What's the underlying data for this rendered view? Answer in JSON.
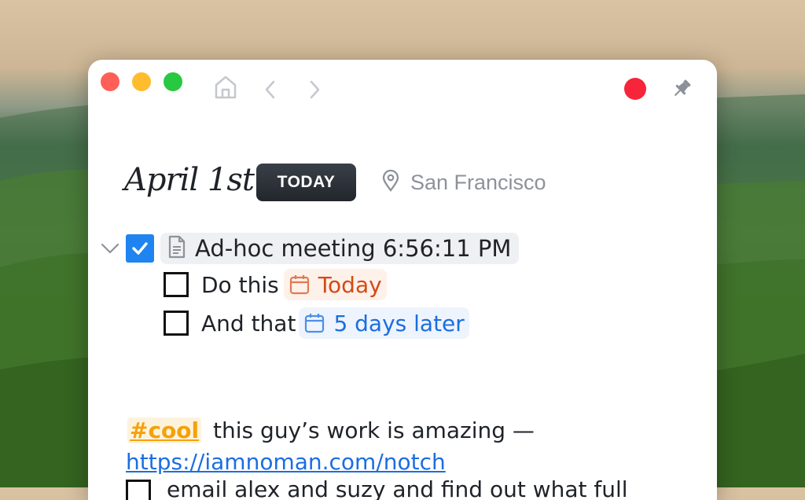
{
  "toolbar": {
    "home_icon": "home-icon",
    "back_icon": "chevron-left-icon",
    "forward_icon": "chevron-right-icon",
    "pin_icon": "pin-icon"
  },
  "header": {
    "title": "April 1st",
    "today_badge": "TODAY",
    "location": "San Francisco"
  },
  "tasks": {
    "parent": {
      "label": "Ad-hoc meeting 6:56:11 PM",
      "checked": true
    },
    "children": [
      {
        "label": "Do this",
        "date": "Today",
        "checked": false
      },
      {
        "label": "And that",
        "date": "5 days later",
        "checked": false
      }
    ]
  },
  "note": {
    "tag": "#cool",
    "text": "this guy’s work is amazing —",
    "link": "https://iamnoman.com/notch",
    "next_line": "email alex and suzy and find out what full"
  },
  "colors": {
    "accent_blue": "#1f84ef",
    "date_orange": "#d34b15",
    "date_blue": "#1b6ee0",
    "tag_orange": "#f5a10b",
    "record_red": "#f6253a"
  }
}
